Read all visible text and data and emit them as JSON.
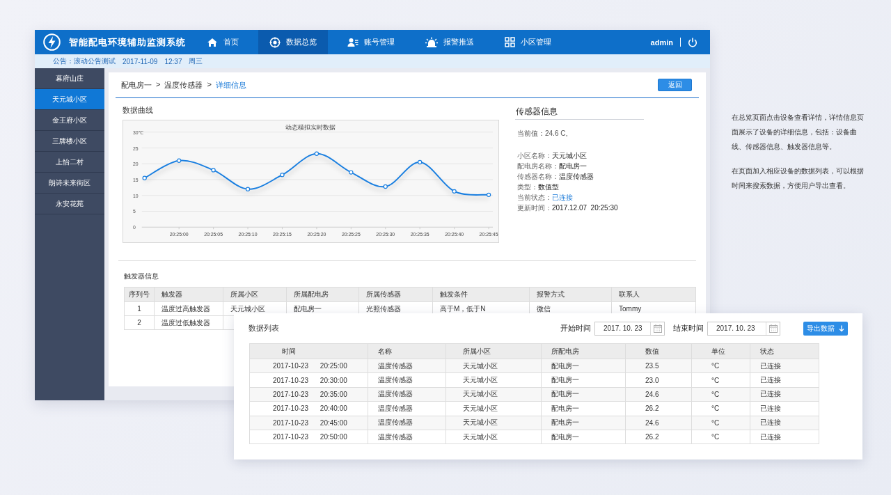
{
  "header": {
    "title": "智能配电环境辅助监测系统",
    "nav": [
      {
        "label": "首页",
        "selected": false
      },
      {
        "label": "数据总览",
        "selected": true
      },
      {
        "label": "账号管理",
        "selected": false
      },
      {
        "label": "报警推送",
        "selected": false
      },
      {
        "label": "小区管理",
        "selected": false
      }
    ],
    "user": "admin"
  },
  "notice": {
    "text": "公告：滚动公告测试",
    "date": "2017-11-09",
    "time": "12:37",
    "weekday": "周三"
  },
  "sidebar": {
    "items": [
      {
        "label": "幕府山庄",
        "selected": false
      },
      {
        "label": "天元城小区",
        "selected": true
      },
      {
        "label": "金王府小区",
        "selected": false
      },
      {
        "label": "三牌楼小区",
        "selected": false
      },
      {
        "label": "上怡二村",
        "selected": false
      },
      {
        "label": "朗诗未来街区",
        "selected": false
      },
      {
        "label": "永安花苑",
        "selected": false
      }
    ]
  },
  "breadcrumb": [
    {
      "kind": "crumb",
      "label": "配电房一"
    },
    {
      "kind": "separator",
      "label": ">"
    },
    {
      "kind": "crumb",
      "label": "温度传感器"
    },
    {
      "kind": "separator",
      "label": ">"
    },
    {
      "kind": "current",
      "label": "详细信息"
    }
  ],
  "back_button": "返回",
  "chart_section": {
    "title": "数据曲线",
    "chart_data": {
      "type": "line",
      "title": "动态模拟实时数据",
      "categories": [
        null,
        "20:25:00",
        "20:25:05",
        "20:25:10",
        "20:25:15",
        "20:25:20",
        "20:25:25",
        "20:25:30",
        "20:25:35",
        "20:25:40",
        "20:25:45"
      ],
      "values": [
        15.5,
        21,
        18,
        12,
        16.5,
        23.2,
        17.3,
        12.8,
        20.5,
        11.3,
        10.2
      ],
      "ylim": [
        0,
        30
      ],
      "grid": true,
      "marker": true,
      "yticks": [
        0,
        5,
        10,
        15,
        20,
        25,
        {
          "value": 30,
          "label": "30℃"
        }
      ]
    }
  },
  "sensor_info": {
    "title": "传感器信息",
    "current_value": "当前值：24.6 C。",
    "fields": [
      {
        "label": "小区名称：",
        "value": "天元城小区",
        "kind": "text"
      },
      {
        "label": "配电房名称：",
        "value": "配电房一",
        "kind": "text"
      },
      {
        "label": "传感器名称：",
        "value": "温度传感器",
        "kind": "text"
      },
      {
        "label": "类型：",
        "value": "数值型",
        "kind": "text"
      },
      {
        "label": "当前状态：",
        "value": "已连接",
        "kind": "status"
      },
      {
        "label": "更新时间：",
        "value": "2017.12.07  20:25:30",
        "kind": "text"
      }
    ]
  },
  "trigger_info": {
    "title": "触发器信息",
    "columns": [
      "序列号",
      "触发器",
      "所属小区",
      "所属配电房",
      "所属传感器",
      "触发条件",
      "报警方式",
      "联系人"
    ],
    "rows": [
      [
        "1",
        "温度过高触发器",
        "天元城小区",
        "配电房一",
        "光照传感器",
        "高于M，低于N",
        "微信",
        "Tommy"
      ],
      [
        "2",
        "温度过低触发器"
      ]
    ]
  },
  "data_list": {
    "title": "数据列表",
    "start": {
      "label": "开始时间",
      "value": "2017. 10. 23"
    },
    "end": {
      "label": "结束时间",
      "value": "2017. 10. 23"
    },
    "export_button": "导出数据",
    "columns": [
      "时间",
      "名称",
      "所属小区",
      "所配电房",
      "数值",
      "单位",
      "状态"
    ],
    "rows": [
      [
        "2017-10-23      20:25:00",
        "温度传感器",
        "天元城小区",
        "配电房一",
        "23.5",
        "°C",
        "已连接"
      ],
      [
        "2017-10-23      20:30:00",
        "温度传感器",
        "天元城小区",
        "配电房一",
        "23.0",
        "°C",
        "已连接"
      ],
      [
        "2017-10-23      20:35:00",
        "温度传感器",
        "天元城小区",
        "配电房一",
        "24.6",
        "°C",
        "已连接"
      ],
      [
        "2017-10-23      20:40:00",
        "温度传感器",
        "天元城小区",
        "配电房一",
        "26.2",
        "°C",
        "已连接"
      ],
      [
        "2017-10-23      20:45:00",
        "温度传感器",
        "天元城小区",
        "配电房一",
        "24.6",
        "°C",
        "已连接"
      ],
      [
        "2017-10-23      20:50:00",
        "温度传感器",
        "天元城小区",
        "配电房一",
        "26.2",
        "°C",
        "已连接"
      ]
    ]
  },
  "notes": [
    "在总览页面点击设备查看详情，详情信息页面展示了设备的详细信息，包括：设备曲线、传感器信息、触发器信息等。",
    "在页面加入相应设备的数据列表，可以根据时间来搜索数据，方便用户导出查看。"
  ]
}
